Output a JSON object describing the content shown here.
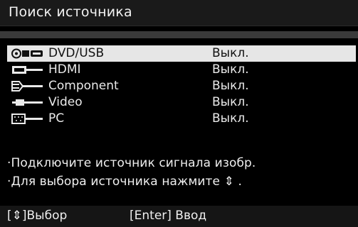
{
  "title": "Поиск источника",
  "sources": [
    {
      "icon": "dvd-usb-icon",
      "name": "DVD/USB",
      "status": "Выкл.",
      "selected": true
    },
    {
      "icon": "hdmi-icon",
      "name": "HDMI",
      "status": "Выкл.",
      "selected": false
    },
    {
      "icon": "component-icon",
      "name": "Component",
      "status": "Выкл.",
      "selected": false
    },
    {
      "icon": "video-icon",
      "name": "Video",
      "status": "Выкл.",
      "selected": false
    },
    {
      "icon": "pc-icon",
      "name": "PC",
      "status": "Выкл.",
      "selected": false
    }
  ],
  "messages": {
    "line1": "·Подключите источник сигнала изобр.",
    "line2": "·Для выбора источника нажмите ⇕ ."
  },
  "footer": {
    "select_hint": "[⇕]Выбор",
    "enter_hint": "[Enter] Ввод"
  },
  "colors": {
    "background": "#000000",
    "titlebar": "#1a1a1a",
    "selected_row": "#e6e6e6"
  }
}
